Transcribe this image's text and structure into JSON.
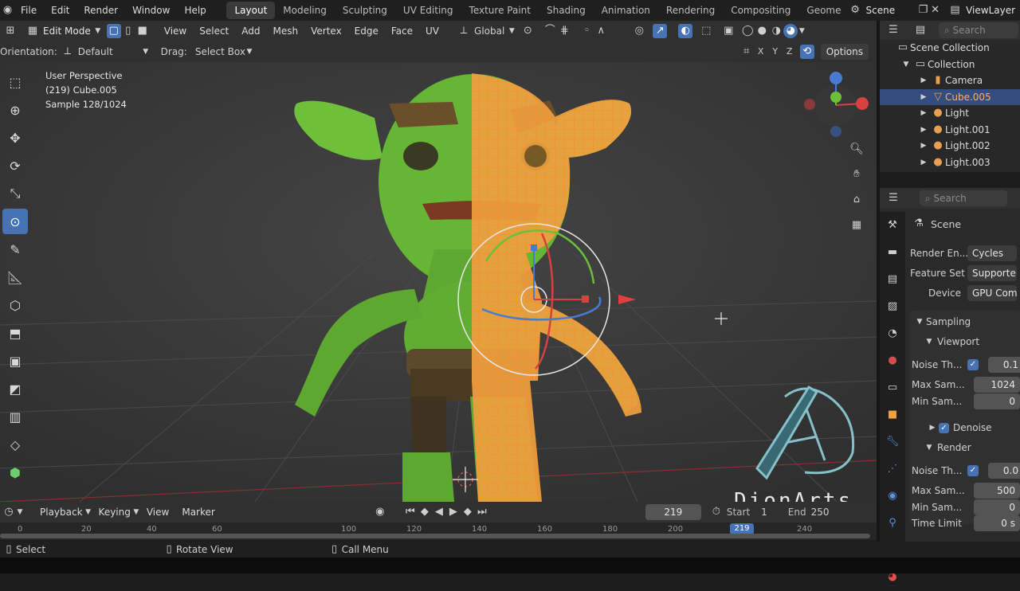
{
  "top_menu": [
    "File",
    "Edit",
    "Render",
    "Window",
    "Help"
  ],
  "workspaces": [
    "Layout",
    "Modeling",
    "Sculpting",
    "UV Editing",
    "Texture Paint",
    "Shading",
    "Animation",
    "Rendering",
    "Compositing",
    "Geome"
  ],
  "scene_name": "Scene",
  "view_layer": "ViewLayer",
  "header": {
    "mode": "Edit Mode",
    "menus": [
      "View",
      "Select",
      "Add",
      "Mesh",
      "Vertex",
      "Edge",
      "Face",
      "UV"
    ],
    "transform_orientation": "Global"
  },
  "subheader": {
    "orientation_label": "Orientation:",
    "orientation_value": "Default",
    "drag_label": "Drag:",
    "drag_value": "Select Box",
    "axis_x": "X",
    "axis_y": "Y",
    "axis_z": "Z",
    "options_label": "Options"
  },
  "viewport": {
    "perspective": "User Perspective",
    "object": "(219) Cube.005",
    "sample": "Sample 128/1024",
    "watermark": "DionArts"
  },
  "outliner": {
    "search_placeholder": "Search",
    "scene_collection": "Scene Collection",
    "collection": "Collection",
    "items": [
      "Camera",
      "Cube.005",
      "Light",
      "Light.001",
      "Light.002",
      "Light.003"
    ],
    "selected": "Cube.005"
  },
  "properties": {
    "search_placeholder": "Search",
    "context": "Scene",
    "render_engine_label": "Render En...",
    "render_engine_value": "Cycles",
    "feature_set_label": "Feature Set",
    "feature_set_value": "Supporte",
    "device_label": "Device",
    "device_value": "GPU Com",
    "sampling_label": "Sampling",
    "viewport_label": "Viewport",
    "vp_noise_label": "Noise Th...",
    "vp_noise_value": "0.1",
    "vp_max_label": "Max Sam...",
    "vp_max_value": "1024",
    "vp_min_label": "Min Sam...",
    "vp_min_value": "0",
    "denoise_label": "Denoise",
    "render_label": "Render",
    "r_noise_label": "Noise Th...",
    "r_noise_value": "0.0",
    "r_max_label": "Max Sam...",
    "r_max_value": "500",
    "r_min_label": "Min Sam...",
    "r_min_value": "0",
    "time_limit_label": "Time Limit",
    "time_limit_value": "0 s"
  },
  "timeline": {
    "menus": [
      "Playback",
      "Keying",
      "View",
      "Marker"
    ],
    "current_frame": "219",
    "start_label": "Start",
    "start_value": "1",
    "end_label": "End",
    "end_value": "250",
    "ruler_ticks": [
      "0",
      "20",
      "40",
      "60",
      "100",
      "120",
      "140",
      "160",
      "180",
      "200",
      "219",
      "240"
    ]
  },
  "statusbar": {
    "select": "Select",
    "rotate_view": "Rotate View",
    "call_menu": "Call Menu"
  },
  "colors": {
    "accent": "#4772b3",
    "selection_orange": "#ff8a1e",
    "goblin_green": "#6fbf3a",
    "viewport_bg": "#3a3a3a"
  }
}
